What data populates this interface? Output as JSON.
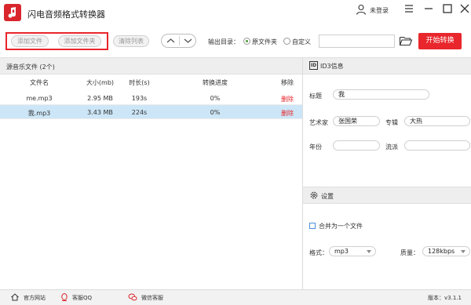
{
  "app": {
    "title": "闪电音频格式转换器"
  },
  "account": {
    "login_label": "未登录"
  },
  "toolbar": {
    "add_file": "添加文件",
    "add_folder": "添加文件夹",
    "clear_list": "清除列表",
    "output_dir_label": "输出目录：",
    "option_source_folder": "原文件夹",
    "option_custom": "自定义",
    "output_path": "",
    "start_button": "开始转换"
  },
  "file_list": {
    "header": "源音乐文件 (2个)",
    "columns": [
      "文件名",
      "大小(mb)",
      "时长(s)",
      "转换进度",
      "移除"
    ],
    "rows": [
      {
        "name": "me.mp3",
        "size": "2.95 MB",
        "duration": "193s",
        "progress": "0%",
        "remove": "删除"
      },
      {
        "name": "我.mp3",
        "size": "3.43 MB",
        "duration": "224s",
        "progress": "0%",
        "remove": "删除"
      }
    ]
  },
  "id3": {
    "icon_text": "ID",
    "title": "ID3信息",
    "title_label": "标题",
    "title_value": "我",
    "artist_label": "艺术家",
    "artist_value": "张国荣",
    "album_label": "专辑",
    "album_value": "大热",
    "year_label": "年份",
    "year_value": "",
    "genre_label": "流派",
    "genre_value": ""
  },
  "settings": {
    "title": "设置",
    "merge_label": "合并为一个文件",
    "format_label": "格式：",
    "format_value": "mp3",
    "quality_label": "质量：",
    "quality_value": "128kbps"
  },
  "footer": {
    "website": "官方网站",
    "qq_support": "客服QQ",
    "wechat_support": "微信客服",
    "version": "版本：v3.1.1"
  },
  "colors": {
    "accent": "#e8262c",
    "selected_row": "#cce6f7",
    "radio_on": "#4a9a3a"
  }
}
